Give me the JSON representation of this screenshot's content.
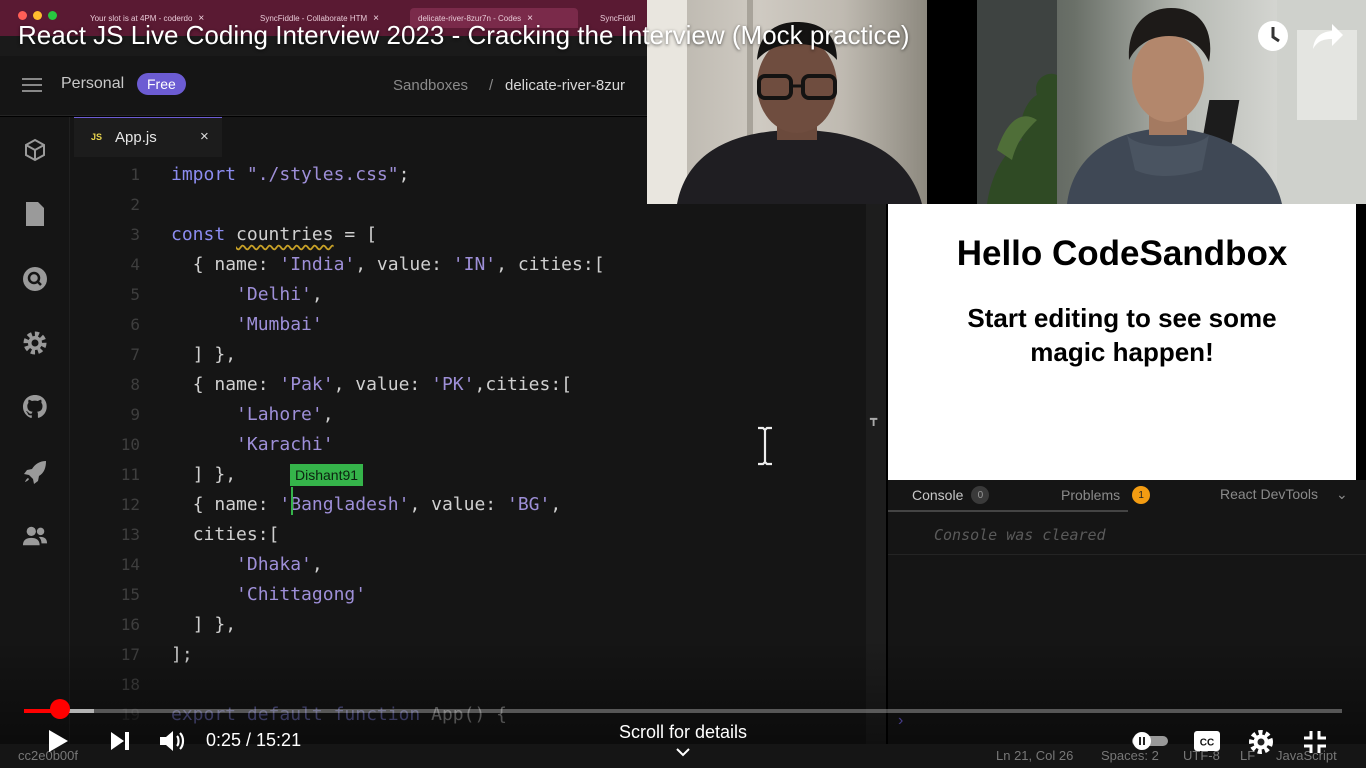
{
  "browser_tabs": [
    {
      "label": "Your slot is at 4PM - coderdo"
    },
    {
      "label": "SyncFiddle - Collaborate HTM"
    },
    {
      "label": "delicate-river-8zur7n - Codes"
    },
    {
      "label": "SyncFiddl"
    }
  ],
  "topbar": {
    "workspace": "Personal",
    "plan_badge": "Free",
    "breadcrumb_root": "Sandboxes",
    "breadcrumb_sep": "/",
    "sandbox_name": "delicate-river-8zur"
  },
  "editor": {
    "tab_type": "JS",
    "tab_name": "App.js",
    "tab_close": "×",
    "collaborator": "Dishant91",
    "lines": [
      {
        "n": "1"
      },
      {
        "n": "2"
      },
      {
        "n": "3"
      },
      {
        "n": "4"
      },
      {
        "n": "5"
      },
      {
        "n": "6"
      },
      {
        "n": "7"
      },
      {
        "n": "8"
      },
      {
        "n": "9"
      },
      {
        "n": "10"
      },
      {
        "n": "11"
      },
      {
        "n": "12"
      },
      {
        "n": "13"
      },
      {
        "n": "14"
      },
      {
        "n": "15"
      },
      {
        "n": "16"
      },
      {
        "n": "17"
      },
      {
        "n": "18"
      },
      {
        "n": "19"
      }
    ],
    "code": {
      "l1_kw": "import",
      "l1_str": "\"./styles.css\"",
      "l1_end": ";",
      "l3_kw": "const",
      "l3_id": "countries",
      "l3_end": " = [",
      "l4_a": "{ name: ",
      "l4_s1": "'India'",
      "l4_b": ", value: ",
      "l4_s2": "'IN'",
      "l4_c": ", cities:[",
      "l5_s": "'Delhi'",
      "l5_end": ",",
      "l6_s": "'Mumbai'",
      "l7": "] },",
      "l8_a": "{ name: ",
      "l8_s1": "'Pak'",
      "l8_b": ", value: ",
      "l8_s2": "'PK'",
      "l8_c": ",cities:[",
      "l9_s": "'Lahore'",
      "l9_end": ",",
      "l10_s": "'Karachi'",
      "l11": "] },",
      "l12_a": "{ name: ",
      "l12_s1": "'Bangladesh'",
      "l12_b": ", value: ",
      "l12_s2": "'BG'",
      "l12_c": ",",
      "l13": "cities:[",
      "l14_s": "'Dhaka'",
      "l14_end": ",",
      "l15_s": "'Chittagong'",
      "l16": "] },",
      "l17": "];",
      "l19_kw1": "export",
      "l19_kw2": "default",
      "l19_kw3": "function",
      "l19_id": "App() {"
    }
  },
  "preview": {
    "heading": "Hello CodeSandbox",
    "subheading": "Start editing to see some magic happen!"
  },
  "console": {
    "tab_console": "Console",
    "console_count": "0",
    "tab_problems": "Problems",
    "problems_count": "1",
    "tab_devtools": "React DevTools",
    "message": "Console was cleared",
    "prompt": "›"
  },
  "statusbar": {
    "commit": "cc2e0b00f",
    "position": "Ln 21, Col 26",
    "spaces": "Spaces: 2",
    "encoding": "UTF-8",
    "eol": "LF",
    "language": "JavaScript"
  },
  "video": {
    "title": "React JS Live Coding Interview 2023 - Cracking the Interview (Mock practice)",
    "current_time": "0:25",
    "duration": "15:21",
    "time_display": "0:25 / 15:21",
    "scroll_hint": "Scroll for details",
    "progress_fraction": 0.027,
    "buffered_fraction": 0.053
  },
  "colors": {
    "accent": "#6c5cd3",
    "progress": "#ff0000",
    "collaborator": "#35b44a",
    "problems_badge": "#f39c12"
  }
}
